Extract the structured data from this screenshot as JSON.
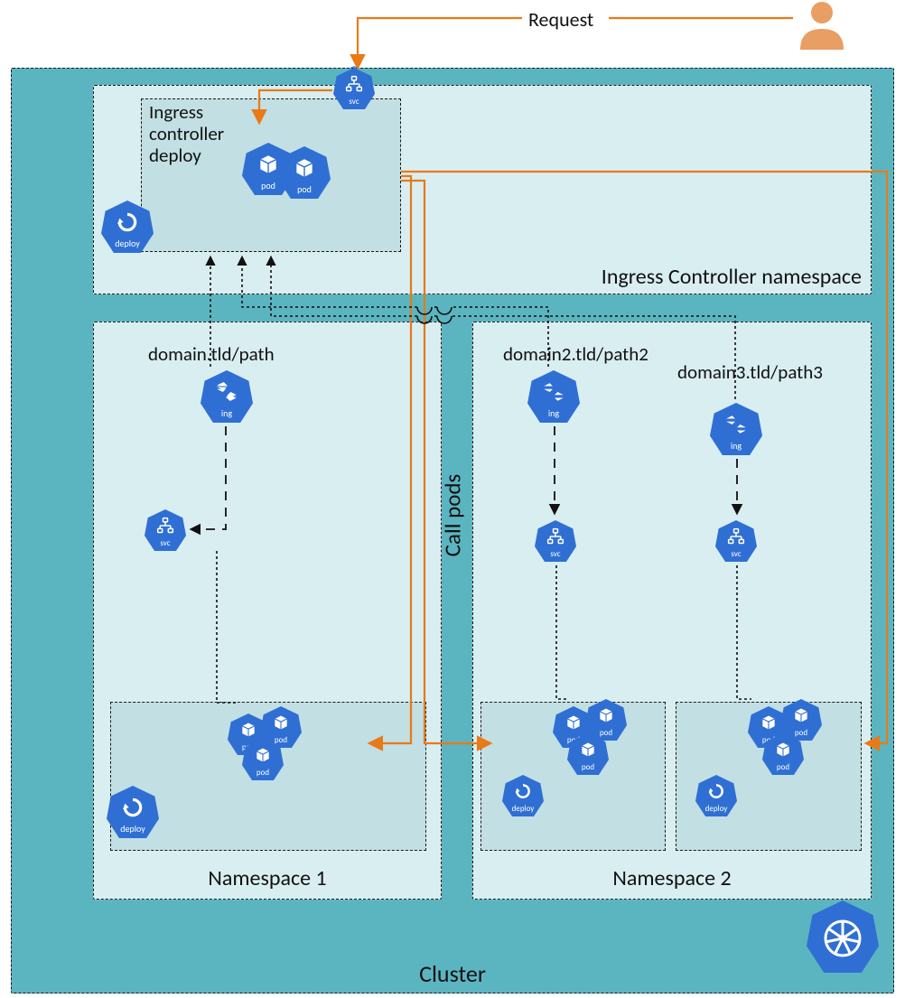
{
  "labels": {
    "request": "Request",
    "cluster": "Cluster",
    "ic_ns": "Ingress Controller namespace",
    "ic_deploy_label": "Ingress controller deploy",
    "call_pods": "Call pods",
    "ns1": "Namespace 1",
    "ns2": "Namespace 2",
    "domain1": "domain.tld/path",
    "domain2": "domain2.tld/path2",
    "domain3": "domain3.tld/path3"
  },
  "icon_labels": {
    "svc": "svc",
    "pod": "pod",
    "deploy": "deploy",
    "ing": "ing"
  },
  "colors": {
    "cluster_bg": "#5bb5c1",
    "ns_bg": "#d9eef1",
    "inner_bg": "#c2dfe3",
    "k8s_blue": "#2f6fd4",
    "accent_orange": "#e87a17"
  },
  "diagram": {
    "request_flow": [
      "user",
      "ingress-svc",
      "ingress-controller-pods"
    ],
    "ingress_reads_from": [
      "ns1.ingress",
      "ns2.ingress-a",
      "ns2.ingress-b"
    ],
    "call_pods_from_ic_to": [
      "ns1.pods",
      "ns2.pods-a",
      "ns2.pods-b"
    ],
    "ns1": {
      "ingress_rule": "domain.tld/path",
      "svc_to_pods": true
    },
    "ns2": {
      "ingress_rules": [
        "domain2.tld/path2",
        "domain3.tld/path3"
      ],
      "svc_to_pods": [
        true,
        true
      ]
    }
  }
}
